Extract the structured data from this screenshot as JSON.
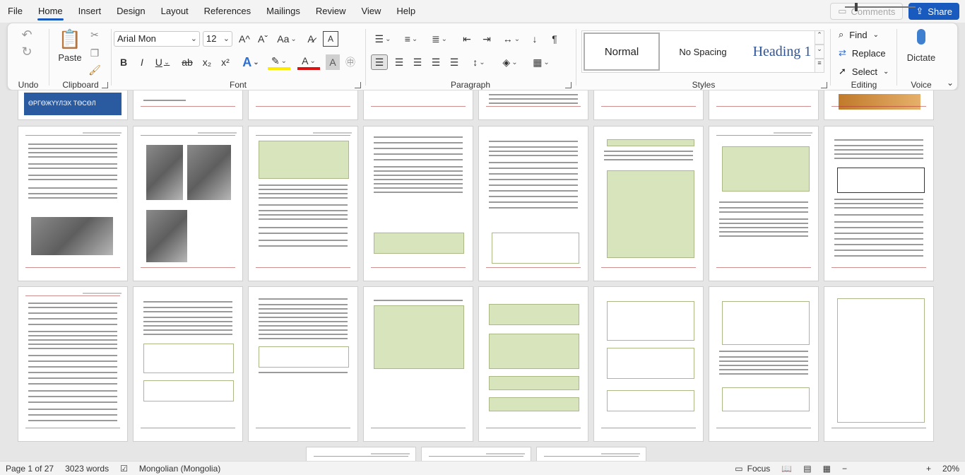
{
  "menu": {
    "tabs": [
      "File",
      "Home",
      "Insert",
      "Design",
      "Layout",
      "References",
      "Mailings",
      "Review",
      "View",
      "Help"
    ],
    "active_index": 1,
    "comments_label": "Comments",
    "share_label": "Share"
  },
  "ribbon": {
    "groups": {
      "undo": "Undo",
      "clipboard": "Clipboard",
      "font": "Font",
      "paragraph": "Paragraph",
      "styles": "Styles",
      "editing": "Editing",
      "voice": "Voice"
    },
    "paste_label": "Paste",
    "font_name": "Arial Mon",
    "font_size": "12",
    "styles": [
      "Normal",
      "No Spacing",
      "Heading 1"
    ],
    "find_label": "Find",
    "replace_label": "Replace",
    "select_label": "Select",
    "dictate_label": "Dictate",
    "font_buttons": [
      "B",
      "I",
      "U",
      "ab",
      "x₂",
      "x²"
    ],
    "grow_label": "A^",
    "shrink_label": "Aˇ",
    "case_label": "Aa",
    "pilcrow": "¶"
  },
  "document": {
    "banner_text": "ӨРГӨЖҮҮЛЭХ ТӨСӨЛ"
  },
  "status": {
    "page": "Page 1 of 27",
    "words": "3023 words",
    "language": "Mongolian (Mongolia)",
    "focus": "Focus",
    "zoom": "20%"
  },
  "colors": {
    "accent": "#185abd",
    "table_fill": "#d8e4bc",
    "heading": "#2f5496"
  }
}
